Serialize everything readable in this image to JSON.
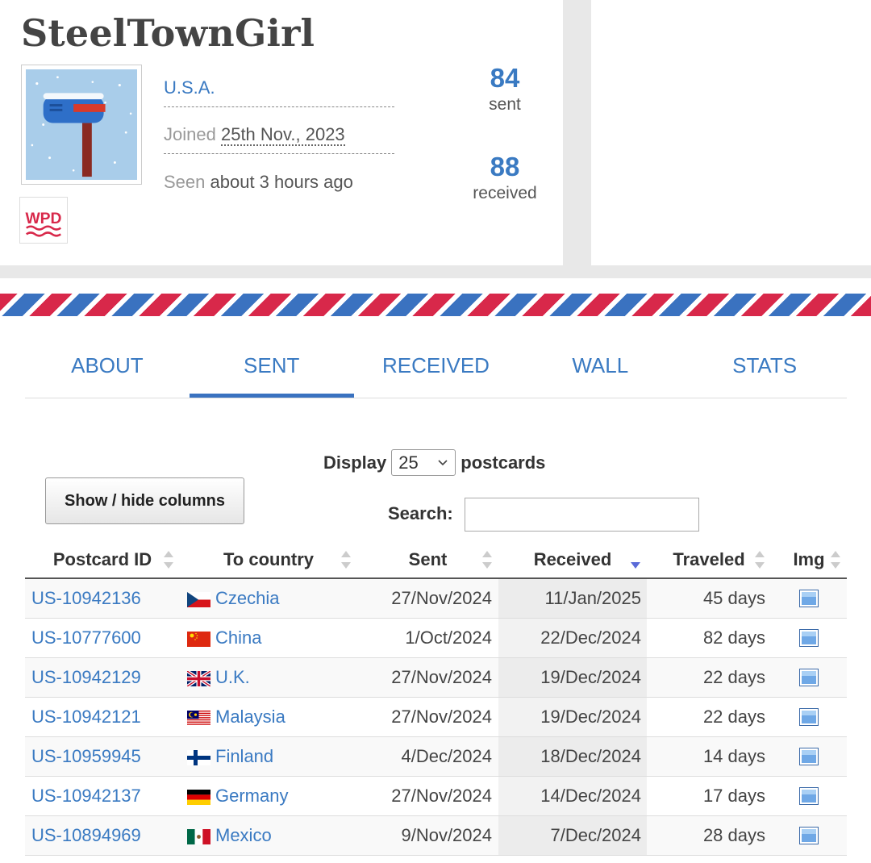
{
  "profile": {
    "username": "SteelTownGirl",
    "country": "U.S.A.",
    "joined_label": "Joined",
    "joined_date": "25th Nov., 2023",
    "seen_label": "Seen",
    "seen_value": "about 3 hours ago",
    "sent_count": "84",
    "sent_label": "sent",
    "received_count": "88",
    "received_label": "received",
    "badge_text": "WPD",
    "avatar_icon": "mailbox-snow-avatar"
  },
  "tabs": [
    {
      "label": "ABOUT",
      "active": false
    },
    {
      "label": "SENT",
      "active": true
    },
    {
      "label": "RECEIVED",
      "active": false
    },
    {
      "label": "WALL",
      "active": false
    },
    {
      "label": "STATS",
      "active": false
    }
  ],
  "controls": {
    "display_prefix": "Display",
    "display_value": "25",
    "display_suffix": "postcards",
    "columns_button": "Show / hide columns",
    "search_label": "Search:",
    "search_value": ""
  },
  "table": {
    "columns": [
      "Postcard ID",
      "To country",
      "Sent",
      "Received",
      "Traveled",
      "Img"
    ],
    "sorted_column": "Received",
    "sort_direction": "desc",
    "rows": [
      {
        "id": "US-10942136",
        "country": "Czechia",
        "flag": "cz",
        "sent": "27/Nov/2024",
        "received": "11/Jan/2025",
        "traveled": "45 days"
      },
      {
        "id": "US-10777600",
        "country": "China",
        "flag": "cn",
        "sent": "1/Oct/2024",
        "received": "22/Dec/2024",
        "traveled": "82 days"
      },
      {
        "id": "US-10942129",
        "country": "U.K.",
        "flag": "gb",
        "sent": "27/Nov/2024",
        "received": "19/Dec/2024",
        "traveled": "22 days"
      },
      {
        "id": "US-10942121",
        "country": "Malaysia",
        "flag": "my",
        "sent": "27/Nov/2024",
        "received": "19/Dec/2024",
        "traveled": "22 days"
      },
      {
        "id": "US-10959945",
        "country": "Finland",
        "flag": "fi",
        "sent": "4/Dec/2024",
        "received": "18/Dec/2024",
        "traveled": "14 days"
      },
      {
        "id": "US-10942137",
        "country": "Germany",
        "flag": "de",
        "sent": "27/Nov/2024",
        "received": "14/Dec/2024",
        "traveled": "17 days"
      },
      {
        "id": "US-10894969",
        "country": "Mexico",
        "flag": "mx",
        "sent": "9/Nov/2024",
        "received": "7/Dec/2024",
        "traveled": "28 days"
      }
    ]
  },
  "colors": {
    "link": "#3a7ac2",
    "airmail_red": "#d8284a",
    "airmail_blue": "#3a72c0"
  }
}
